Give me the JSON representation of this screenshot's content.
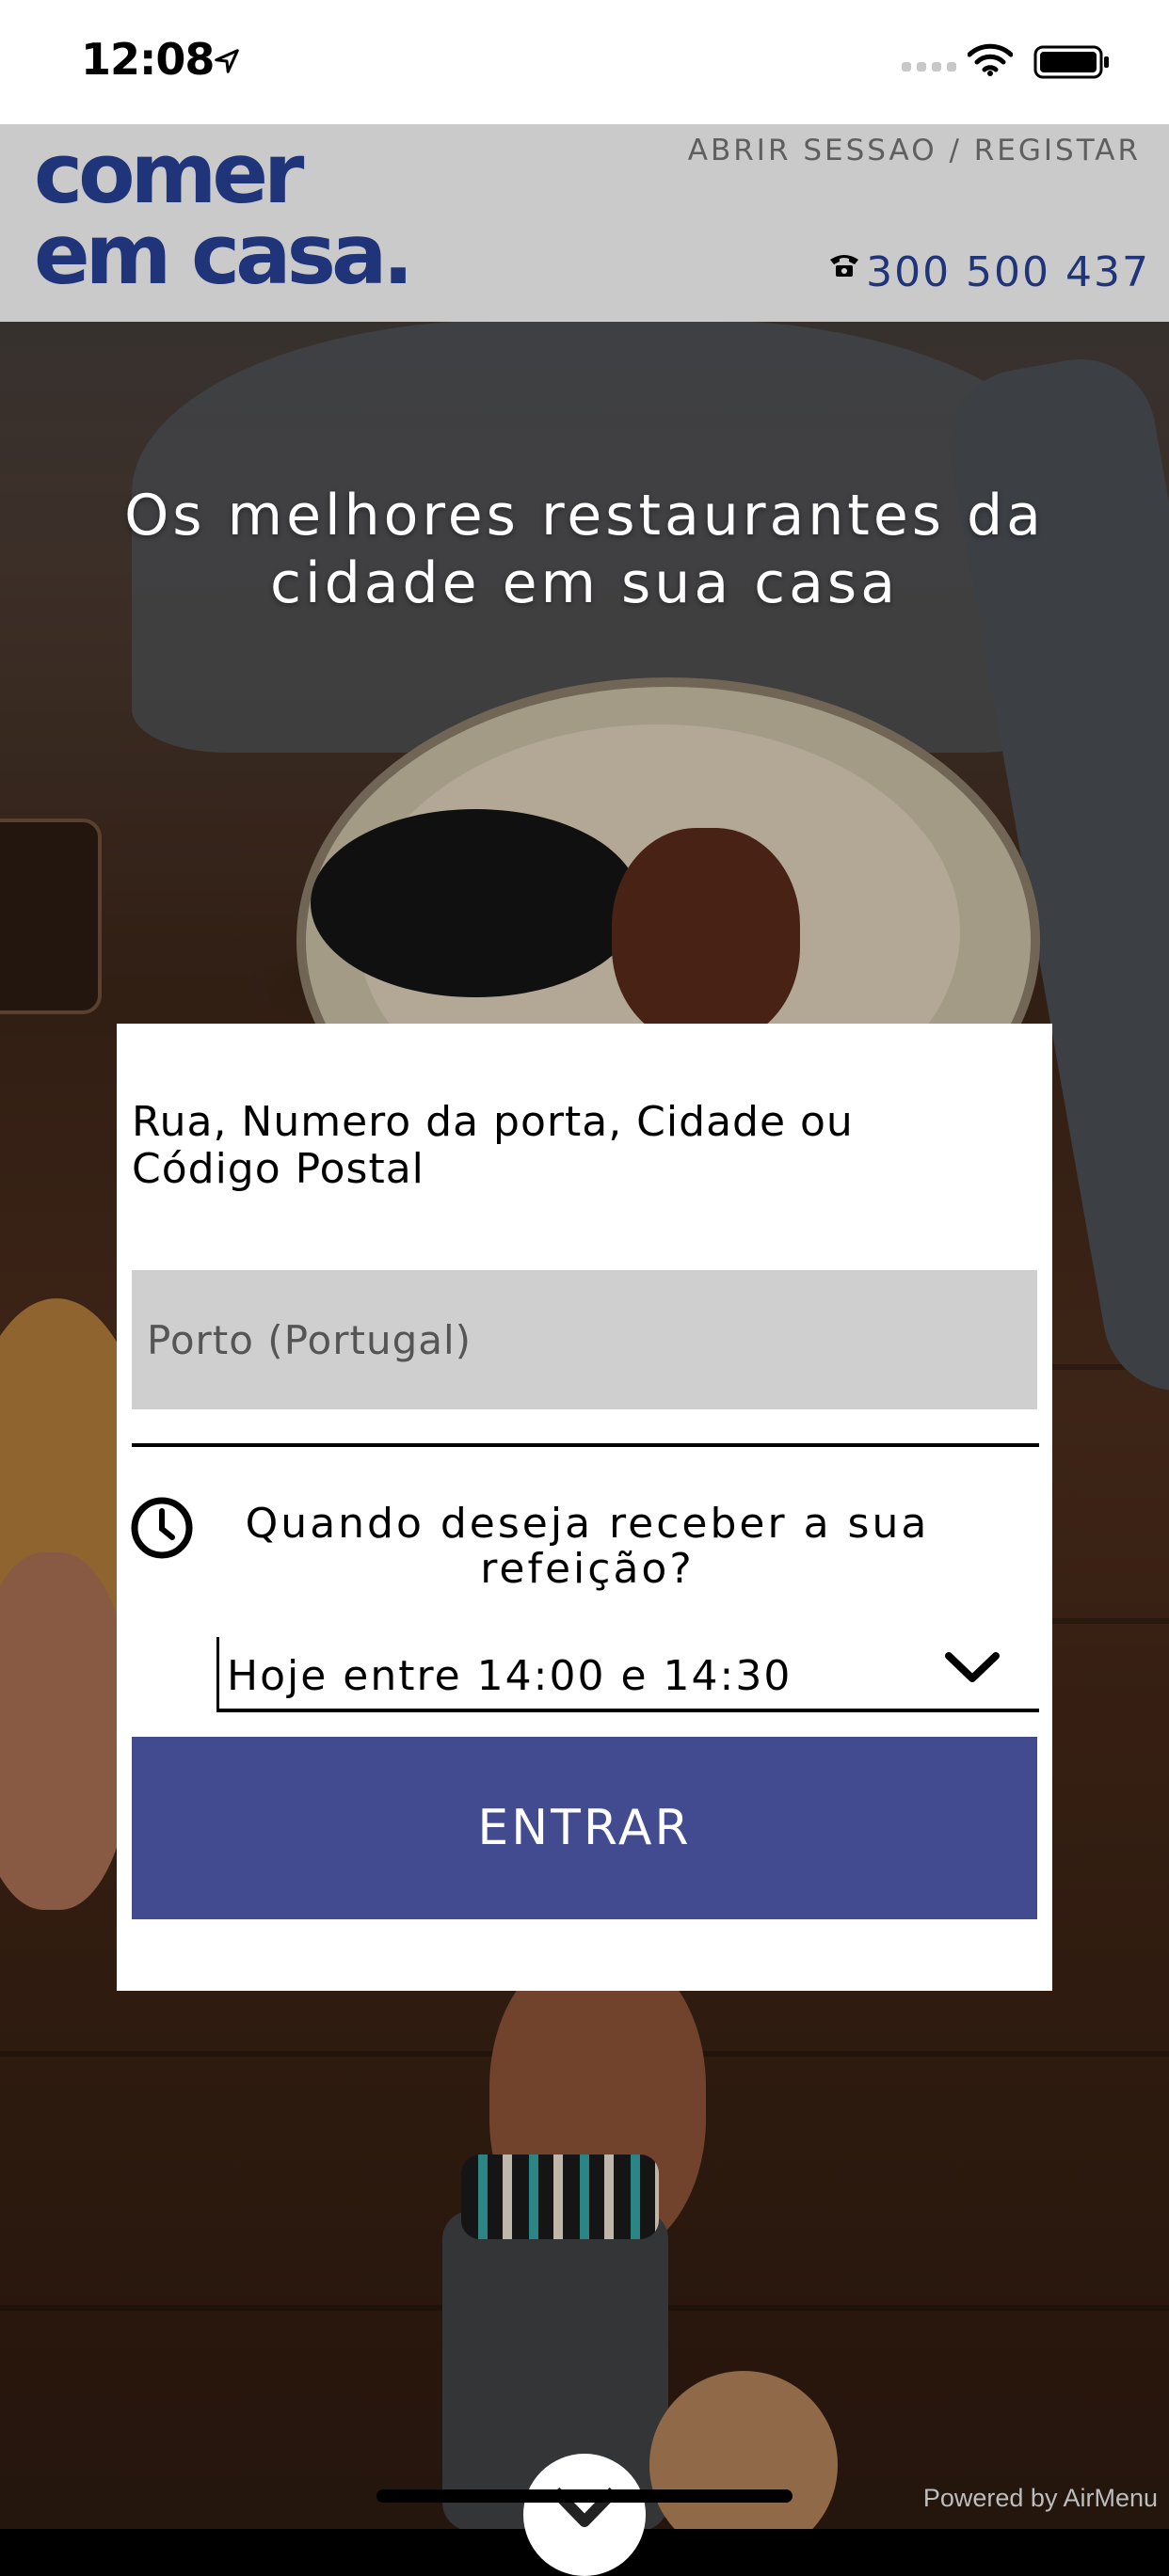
{
  "status_bar": {
    "time": "12:08"
  },
  "header": {
    "logo_line1": "comer",
    "logo_line2": "em casa.",
    "auth_link": "ABRIR SESSAO / REGISTAR",
    "phone": "300 500 437"
  },
  "hero": {
    "line1": "Os melhores restaurantes da",
    "line2": "cidade em sua casa"
  },
  "form": {
    "address_label": "Rua, Numero da porta, Cidade ou Código Postal",
    "address_value": "Porto (Portugal)",
    "when_label": "Quando deseja receber a sua refeição?",
    "time_selected": "Hoje entre 14:00 e 14:30",
    "submit_label": "ENTRAR"
  },
  "footer": {
    "powered_by": "Powered by AirMenu"
  },
  "colors": {
    "brand_blue": "#1f3479",
    "button_blue": "#424b90",
    "header_bg": "#d6d6d6",
    "input_bg": "#cfcfcf"
  }
}
